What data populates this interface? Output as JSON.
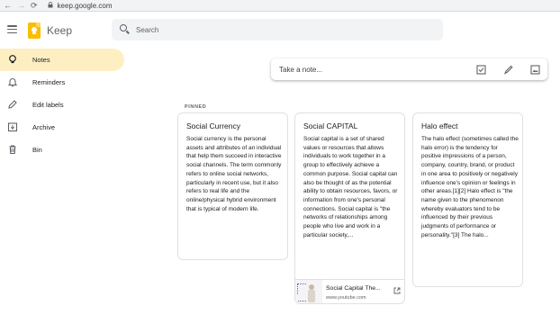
{
  "browser": {
    "back": "←",
    "forward": "→",
    "reload": "⟳",
    "url": "keep.google.com"
  },
  "header": {
    "app_title": "Keep",
    "search_placeholder": "Search"
  },
  "sidebar": {
    "items": [
      {
        "label": "Notes",
        "icon": "lightbulb-icon",
        "active": true
      },
      {
        "label": "Reminders",
        "icon": "bell-icon",
        "active": false
      },
      {
        "label": "Edit labels",
        "icon": "pencil-icon",
        "active": false
      },
      {
        "label": "Archive",
        "icon": "archive-icon",
        "active": false
      },
      {
        "label": "Bin",
        "icon": "trash-icon",
        "active": false
      }
    ]
  },
  "take_note": {
    "placeholder": "Take a note...",
    "tools": [
      "checkbox-icon",
      "brush-icon",
      "image-icon"
    ]
  },
  "section": {
    "pinned_label": "PINNED"
  },
  "notes": [
    {
      "title": "Social Currency",
      "body": "Social currency is the personal assets and attributes of an individual that help them succeed in interactive social channels. The term commonly refers to online social networks, particularly in recent use, but it also refers to real life and the online/physical hybrid environment that is typical of modern life."
    },
    {
      "title": "Social CAPITAL",
      "body": "Social capital is a set of shared values or resources that allows individuals to work together in a group to effectively achieve a common purpose. Social capital can also be thought of as the potential ability to obtain resources, favors, or information from one's personal connections. Social capital is \"the networks of relationships among people who live and work in a particular society,...",
      "link": {
        "title": "Social Capital The...",
        "domain": "www.youtube.com"
      }
    },
    {
      "title": "Halo effect",
      "body": "The halo effect (sometimes called the halo error) is the tendency for positive impressions of a person, company, country, brand, or product in one area to positively or negatively influence one's opinion or feelings in other areas.[1][2] Halo effect is \"the name given to the phenomenon whereby evaluators tend to be influenced by their previous judgments of performance or personality.\"[3] The halo..."
    }
  ],
  "colors": {
    "active_nav": "#feefc3",
    "logo": "#fbbc04",
    "search_bg": "#f1f3f4"
  }
}
